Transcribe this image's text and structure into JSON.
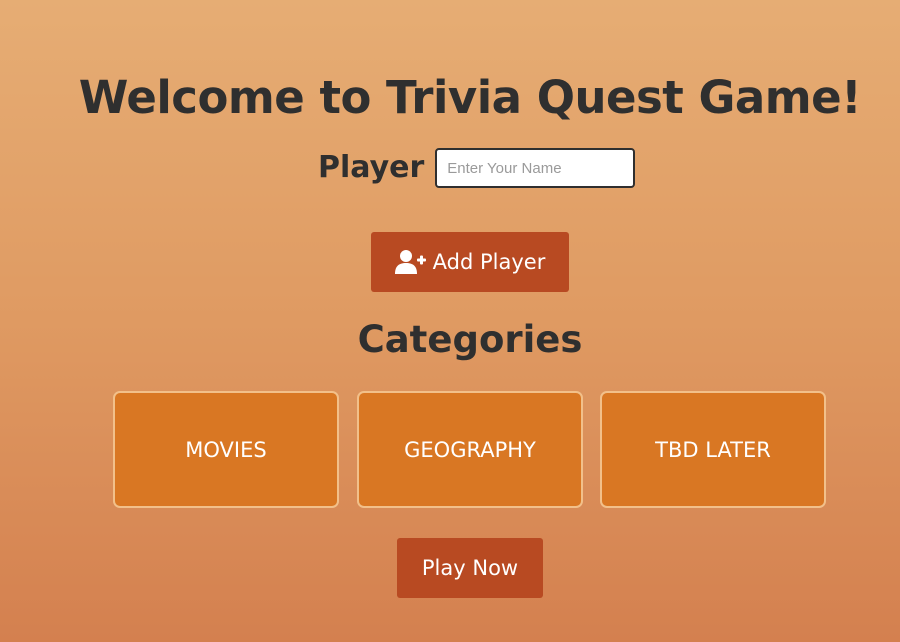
{
  "header": {
    "title": "Welcome to Trivia Quest Game!"
  },
  "player": {
    "label": "Player",
    "input_value": "",
    "placeholder": "Enter Your Name"
  },
  "add_player": {
    "label": "Add Player",
    "icon": "user-plus-icon"
  },
  "categories": {
    "heading": "Categories",
    "items": [
      {
        "label": "MOVIES"
      },
      {
        "label": "GEOGRAPHY"
      },
      {
        "label": "TBD LATER"
      }
    ]
  },
  "play": {
    "label": "Play Now"
  },
  "colors": {
    "background_top": "#e6ad74",
    "background_bottom": "#d4804f",
    "button": "#b84a22",
    "card": "#d97723",
    "card_border": "#f2c08a",
    "text_dark": "#2f2f2f"
  }
}
